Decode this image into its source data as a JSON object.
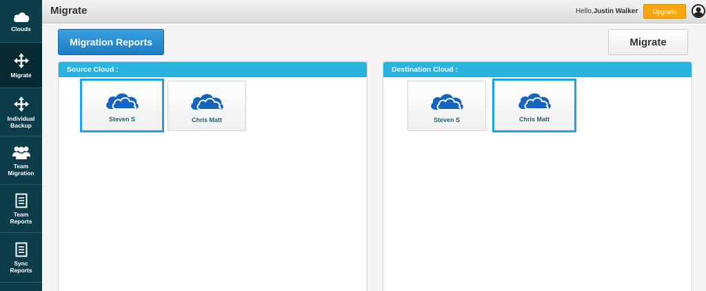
{
  "sidebar": {
    "items": [
      {
        "label": "Clouds",
        "icon": "cloud-icon"
      },
      {
        "label": "Migrate",
        "icon": "arrows-move-icon"
      },
      {
        "label": "Individual Backup",
        "icon": "arrows-move-icon"
      },
      {
        "label": "Team Migration",
        "icon": "team-icon"
      },
      {
        "label": "Team Reports",
        "icon": "document-icon"
      },
      {
        "label": "Sync Reports",
        "icon": "document-icon"
      }
    ]
  },
  "header": {
    "title": "Migrate",
    "greeting_prefix": "Hello,",
    "user_name": "Justin Walker",
    "upgrade_label": "Upgrade"
  },
  "main": {
    "reports_label": "Migration Reports",
    "migrate_label": "Migrate",
    "source": {
      "title": "Source Cloud :",
      "accounts": [
        {
          "name": "Steven S",
          "selected": true
        },
        {
          "name": "Chris Matt",
          "selected": false
        }
      ]
    },
    "destination": {
      "title": "Destination Cloud :",
      "accounts": [
        {
          "name": "Steven S",
          "selected": false
        },
        {
          "name": "Chris Matt",
          "selected": true
        }
      ]
    }
  },
  "colors": {
    "sidebar": "#0d3d4a",
    "panel_header": "#2ab3dd",
    "reports_button": "#1f7cc2",
    "upgrade_button": "#f7a70f",
    "onedrive_cloud": "#1565c0",
    "selected_border": "#1aa3e8"
  }
}
